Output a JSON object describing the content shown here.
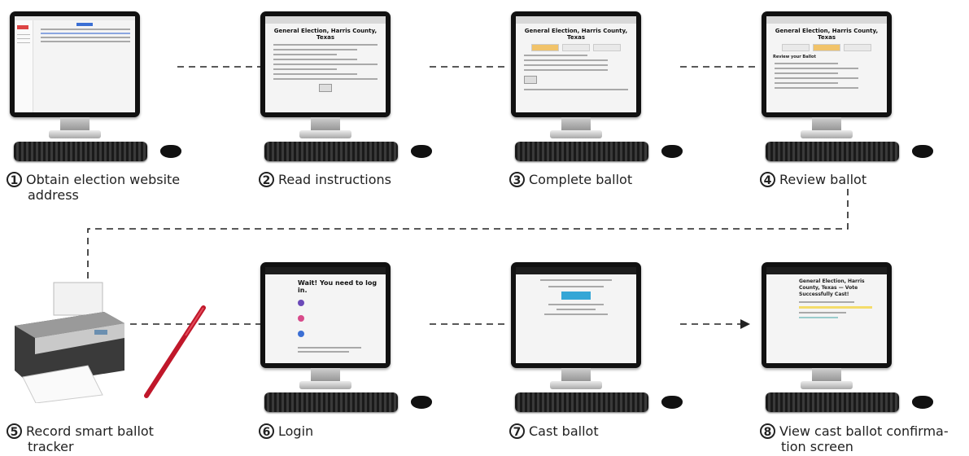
{
  "steps": [
    {
      "number": "1",
      "line1": "Obtain election website",
      "line2": "address"
    },
    {
      "number": "2",
      "line1": "Read instructions",
      "line2": ""
    },
    {
      "number": "3",
      "line1": "Complete ballot",
      "line2": ""
    },
    {
      "number": "4",
      "line1": "Review ballot",
      "line2": ""
    },
    {
      "number": "5",
      "line1": "Record smart ballot",
      "line2": "tracker"
    },
    {
      "number": "6",
      "line1": "Login",
      "line2": ""
    },
    {
      "number": "7",
      "line1": "Cast ballot",
      "line2": ""
    },
    {
      "number": "8",
      "line1": "View cast ballot confirma-",
      "line2": "tion screen"
    }
  ],
  "screens": {
    "s2_title": "General Election, Harris County, Texas",
    "s3_title": "General Election, Harris County, Texas",
    "s4_title": "General Election, Harris County, Texas",
    "s4_sub": "Review your Ballot",
    "s6_heading": "Wait! You need to log in.",
    "s8_heading": "General Election, Harris County, Texas — Vote Successfully Cast!"
  },
  "colors": {
    "connector": "#222222",
    "pen": "#c0172a",
    "button_blue": "#35a6d6"
  }
}
